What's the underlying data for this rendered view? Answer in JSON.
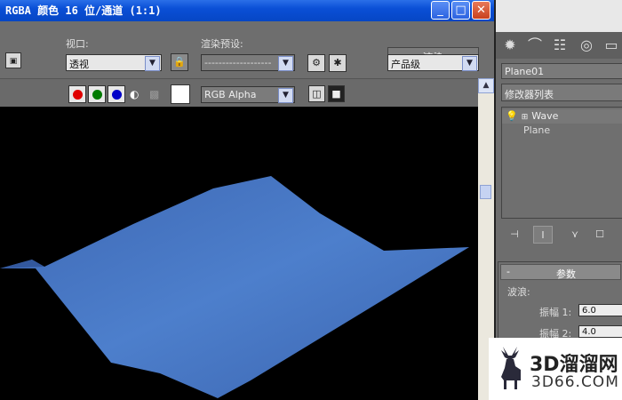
{
  "window": {
    "title": "RGBA 颜色 16 位/通道 (1:1)",
    "min_icon": "_",
    "max_icon": "□",
    "close_icon": "✕"
  },
  "toolbar": {
    "viewport_label": "视口:",
    "viewport_value": "透视",
    "preset_label": "渲染预设:",
    "preset_value": "-------------------",
    "render_button": "渲染",
    "quality_value": "产品级",
    "channel_display": "RGB Alpha"
  },
  "command_panel": {
    "object_name": "Plane01",
    "modifier_list": "修改器列表",
    "stack": [
      {
        "label": "Wave"
      },
      {
        "label": "Plane"
      }
    ],
    "rollout_title": "参数",
    "rollout_minus": "-",
    "group_label": "波浪:",
    "amp1_label": "振幅 1:",
    "amp1_value": "6.0",
    "amp2_label": "振幅 2:",
    "amp2_value": "4.0"
  },
  "watermark": {
    "line1": "3D溜溜网",
    "line2": "3D66.COM"
  },
  "colors": {
    "titlebar": "#0a4fd6",
    "plane": "#4a78c4",
    "background": "#000000"
  }
}
